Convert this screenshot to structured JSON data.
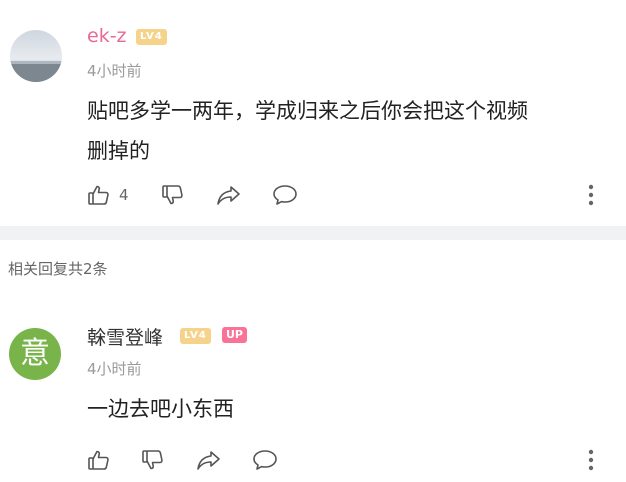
{
  "comments": [
    {
      "username": "ek-z",
      "level": "LV4",
      "time": "4小时前",
      "text_line1": "贴吧多学一两年，学成归来之后你会把这个视频",
      "text_line2": "删掉的",
      "likes": "4",
      "username_color": "#e86a92"
    },
    {
      "username": "榦雪登峰",
      "level": "LV4",
      "up_badge": "UP",
      "time": "4小时前",
      "text": "一边去吧小东西",
      "avatar_char": "意",
      "username_color": "#333333"
    }
  ],
  "replies_label": "相关回复共2条",
  "colors": {
    "level_badge_bg": "#f6d38a",
    "up_badge_bg": "#fb7299",
    "divider": "#f1f2f3",
    "avatar_green": "#79b44b"
  },
  "icons": [
    "thumbs-up-icon",
    "thumbs-down-icon",
    "share-icon",
    "comment-icon",
    "more-icon"
  ]
}
